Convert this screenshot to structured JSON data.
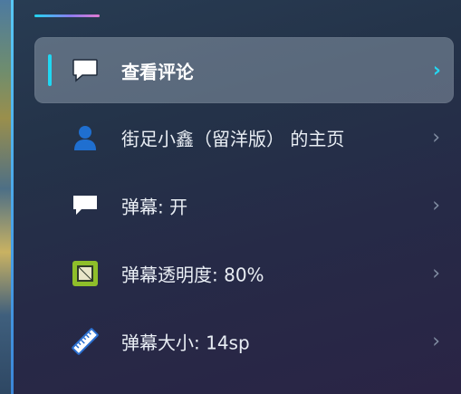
{
  "menu": {
    "items": [
      {
        "label": "查看评论",
        "icon": "comment-icon",
        "active": true
      },
      {
        "label": "街足小鑫（留洋版） 的主页",
        "icon": "user-icon",
        "active": false
      },
      {
        "label": "弹幕: 开",
        "icon": "danmaku-icon",
        "active": false
      },
      {
        "label": "弹幕透明度: 80%",
        "icon": "opacity-icon",
        "active": false
      },
      {
        "label": "弹幕大小: 14sp",
        "icon": "ruler-icon",
        "active": false
      }
    ],
    "chevron": "›"
  },
  "colors": {
    "accent": "#20d7f2",
    "user_icon": "#1f6fd0",
    "opacity_icon": "#8fbf2a"
  }
}
